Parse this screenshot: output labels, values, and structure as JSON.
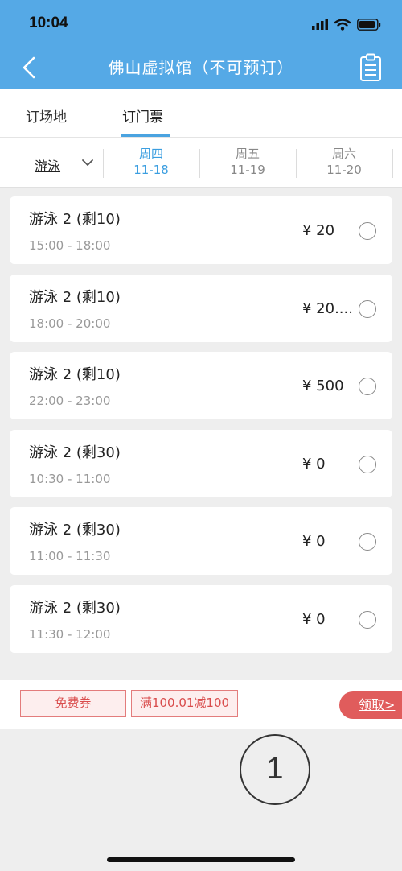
{
  "status_bar": {
    "time": "10:04"
  },
  "header": {
    "title": "佛山虚拟馆（不可预订）"
  },
  "tabs": [
    {
      "label": "订场地"
    },
    {
      "label": "订门票"
    }
  ],
  "filter": {
    "sport": "游泳",
    "days": [
      {
        "weekday": "周四",
        "date": "11-18",
        "active": true
      },
      {
        "weekday": "周五",
        "date": "11-19",
        "active": false
      },
      {
        "weekday": "周六",
        "date": "11-20",
        "active": false
      }
    ]
  },
  "tickets": [
    {
      "name": "游泳 2 (剩10)",
      "time": "15:00 - 18:00",
      "price": "¥ 20"
    },
    {
      "name": "游泳 2 (剩10)",
      "time": "18:00 - 20:00",
      "price": "¥ 20...."
    },
    {
      "name": "游泳 2 (剩10)",
      "time": "22:00 - 23:00",
      "price": "¥ 500"
    },
    {
      "name": "游泳 2 (剩30)",
      "time": "10:30 - 11:00",
      "price": "¥ 0"
    },
    {
      "name": "游泳 2 (剩30)",
      "time": "11:00 - 11:30",
      "price": "¥ 0"
    },
    {
      "name": "游泳 2 (剩30)",
      "time": "11:30 - 12:00",
      "price": "¥ 0"
    }
  ],
  "coupons": [
    {
      "label": "免费券"
    },
    {
      "label": "满100.01减100"
    }
  ],
  "claim_label": "领取>",
  "overlay_number": "1",
  "colors": {
    "header": "#55a9e6",
    "accent": "#3b9ee0",
    "coupon": "#d94c4c",
    "claim": "#e05c5c"
  }
}
